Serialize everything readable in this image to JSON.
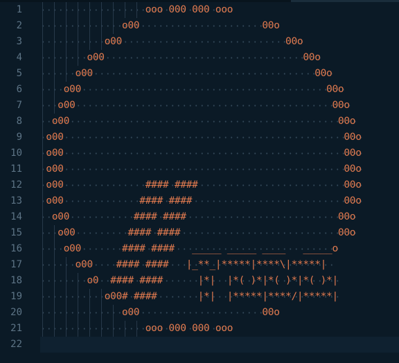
{
  "editor": {
    "line_numbers": [
      "1",
      "2",
      "3",
      "4",
      "5",
      "6",
      "7",
      "8",
      "9",
      "10",
      "11",
      "12",
      "13",
      "14",
      "15",
      "16",
      "17",
      "18",
      "19",
      "20",
      "21",
      "22"
    ],
    "lines": [
      "                  ooo 000 000 ooo",
      "              o00                     00o",
      "           o00                            00o",
      "        o00                                  00o",
      "      o00                                      00o",
      "    o00                                          00o",
      "   o00                                            00o",
      "  o00                                              00o",
      " o00                                                00o",
      " o00                                                00o",
      " o00                                                00o",
      " o00              #### ####                         00o",
      " o00             #### ####                          00o",
      "  o00           #### ####                          00o",
      "   o00         #### ####                           00o",
      "    o00       #### ####   _____ _____ ____   _____o",
      "      o00    #### ####   |_*​*_|*****|****\\|*****|",
      "        o0  #### ####      |*|  |*( )*|*( )*|*( )*|",
      "           o00# ####       |*|  |*****|****/|*****|",
      "              o00                     00o",
      "                  ooo 000 000 ooo",
      ""
    ]
  }
}
